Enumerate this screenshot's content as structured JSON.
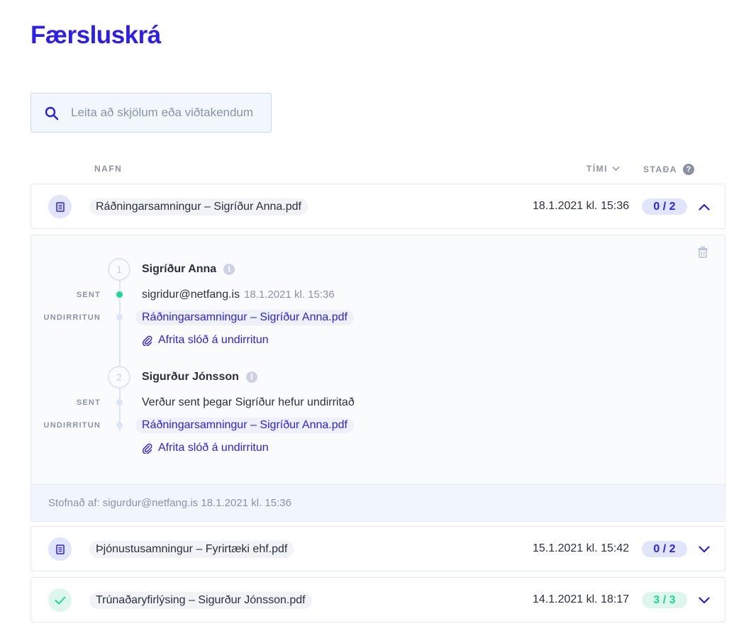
{
  "page_title": "Færsluskrá",
  "search": {
    "placeholder": "Leita að skjölum eða viðtakendum",
    "value": ""
  },
  "columns": {
    "name": "NAFN",
    "time": "TÍMI",
    "status": "STAÐA",
    "help": "?"
  },
  "rows": [
    {
      "file": "Ráðningarsamningur – Sigríður Anna.pdf",
      "time": "18.1.2021 kl. 15:36",
      "status": "0 / 2",
      "state": "pending",
      "expanded": true
    },
    {
      "file": "Þjónustusamningur – Fyrirtæki ehf.pdf",
      "time": "15.1.2021 kl. 15:42",
      "status": "0 / 2",
      "state": "pending",
      "expanded": false
    },
    {
      "file": "Trúnaðaryfirlýsing – Sigurður Jónsson.pdf",
      "time": "14.1.2021 kl. 18:17",
      "status": "3 / 3",
      "state": "done",
      "expanded": false
    }
  ],
  "detail": {
    "labels": {
      "sent": "SENT",
      "signature": "UNDIRRITUN"
    },
    "signers": [
      {
        "number": "1",
        "name": "Sigríður Anna",
        "sent_text": "sigridur@netfang.is",
        "sent_time": "18.1.2021 kl. 15:36",
        "sent_done": true,
        "document": "Ráðningarsamningur – Sigríður Anna.pdf",
        "copy_link": "Afrita slóð á undirritun"
      },
      {
        "number": "2",
        "name": "Sigurður Jónsson",
        "sent_text": "Verður sent þegar Sigríður hefur undirritað",
        "sent_time": "",
        "sent_done": false,
        "document": "Ráðningarsamningur – Sigríður Anna.pdf",
        "copy_link": "Afrita slóð á undirritun"
      }
    ],
    "footer": "Stofnað af: sigurdur@netfang.is 18.1.2021 kl. 15:36"
  },
  "icons": {
    "search": "search-icon",
    "document": "document-icon",
    "check": "check-icon",
    "chevron_up": "chevron-up-icon",
    "chevron_down": "chevron-down-icon",
    "trash": "trash-icon",
    "info": "info-icon",
    "link": "paperclip-icon"
  },
  "colors": {
    "accent": "#2d1ef0",
    "success": "#1ed695",
    "muted": "#8c92a6",
    "pill_bg": "#e0e5fa",
    "success_bg": "#def7ee"
  }
}
